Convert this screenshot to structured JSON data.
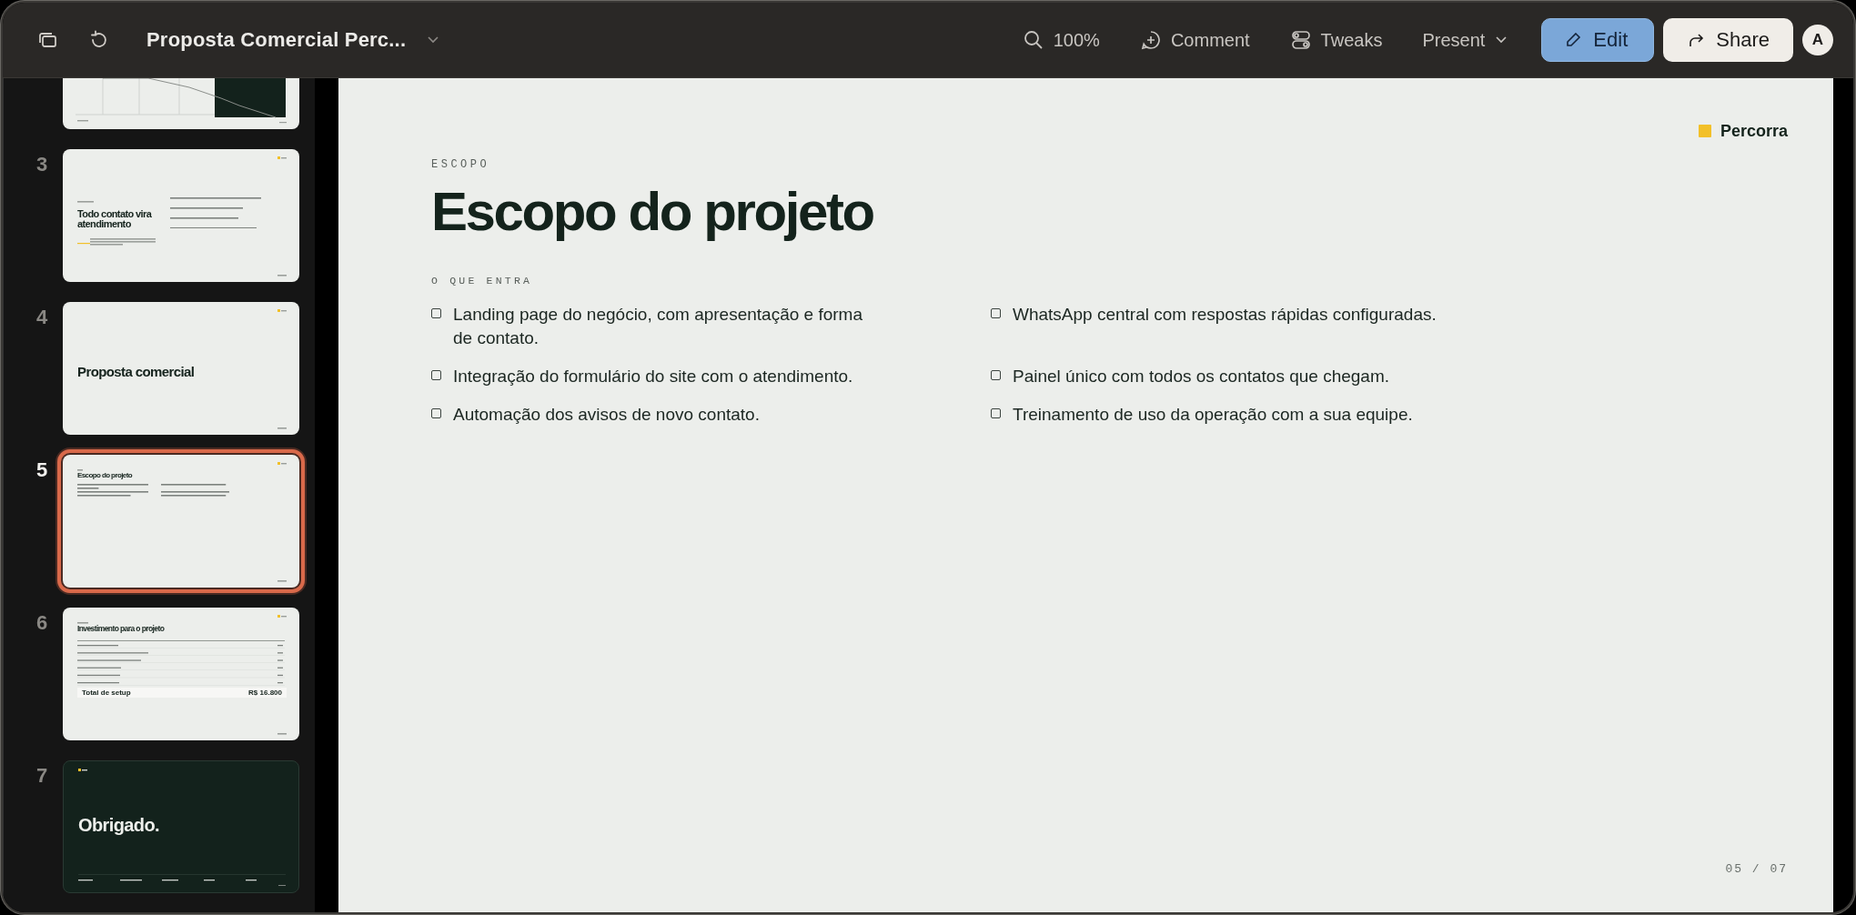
{
  "window": {
    "title": "Proposta Comercial Perc..."
  },
  "toolbar": {
    "zoom": "100%",
    "comment": "Comment",
    "tweaks": "Tweaks",
    "present": "Present",
    "edit": "Edit",
    "share": "Share",
    "avatar": "A"
  },
  "slides": [
    {
      "kind": "chart",
      "selected": false
    },
    {
      "number": "3",
      "kind": "split",
      "title": "Todo contato vira atendimento",
      "selected": false
    },
    {
      "number": "4",
      "kind": "cover",
      "title": "Proposta comercial",
      "selected": false
    },
    {
      "number": "5",
      "kind": "list",
      "title": "Escopo do projeto",
      "selected": true
    },
    {
      "number": "6",
      "kind": "table",
      "title": "Investimento para o projeto",
      "total_label": "Total de setup",
      "total_value": "R$ 16.800",
      "selected": false
    },
    {
      "number": "7",
      "kind": "closing",
      "title": "Obrigado.",
      "selected": false
    }
  ],
  "slide": {
    "brand": "Percorra",
    "eyebrow": "ESCOPO",
    "title": "Escopo do projeto",
    "section": "O QUE ENTRA",
    "items": [
      {
        "text": "Landing page do negócio, com apresentação e forma de contato.",
        "checked": false
      },
      {
        "text": "WhatsApp central com respostas rápidas configuradas.",
        "checked": false
      },
      {
        "text": "Integração do formulário do site com o atendimento.",
        "checked": false
      },
      {
        "text": "Painel único com todos os contatos que chegam.",
        "checked": false
      },
      {
        "text": "Automação dos avisos de novo contato.",
        "checked": false
      },
      {
        "text": "Treinamento de uso da operação com a sua equipe.",
        "checked": false
      }
    ],
    "page": "05 / 07"
  }
}
